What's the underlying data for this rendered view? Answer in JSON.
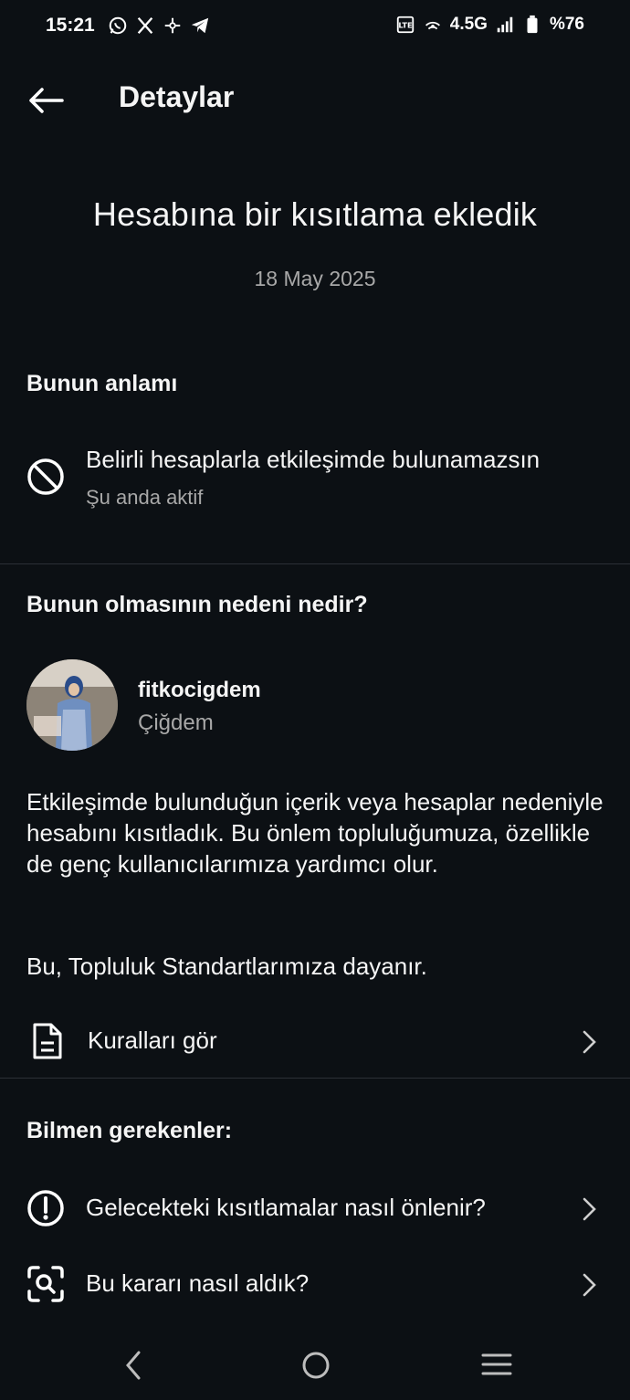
{
  "status_bar": {
    "time": "15:21",
    "network": "4.5G",
    "battery": "%76",
    "left_icons": [
      "whatsapp-icon",
      "x-icon",
      "app-icon",
      "telegram-icon"
    ]
  },
  "header": {
    "title": "Detaylar",
    "back_icon": "arrow-left-icon"
  },
  "main": {
    "title": "Hesabına bir kısıtlama ekledik",
    "date": "18 May 2025"
  },
  "meaning": {
    "heading": "Bunun anlamı",
    "item_label": "Belirli hesaplarla etkileşimde bulunamazsın",
    "item_status": "Şu anda aktif",
    "icon": "block-icon"
  },
  "reason": {
    "heading": "Bunun olmasının nedeni nedir?",
    "account_username": "fitkocigdem",
    "account_name": "Çiğdem",
    "paragraph": "Etkileşimde bulunduğun içerik veya hesaplar nedeniyle hesabını kısıtladık. Bu önlem topluluğumuza, özellikle de genç kullanıcılarımıza yardımcı olur.",
    "standards": "Bu, Topluluk Standartlarımıza dayanır.",
    "rules_link": "Kuralları gör"
  },
  "know": {
    "heading": "Bilmen gerekenler:",
    "items": [
      {
        "label": "Gelecekteki kısıtlamalar nasıl önlenir?",
        "icon": "alert-circle-icon"
      },
      {
        "label": "Bu kararı nasıl aldık?",
        "icon": "search-scan-icon"
      }
    ]
  },
  "colors": {
    "background": "#0c1014",
    "text": "#f5f5f5",
    "secondary": "#a8a8a8"
  }
}
